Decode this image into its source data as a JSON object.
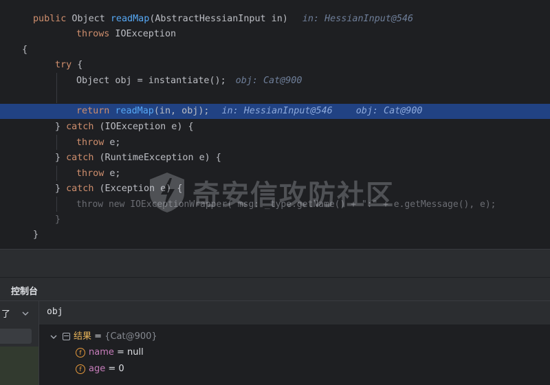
{
  "editor": {
    "lines": {
      "l1": {
        "kw": "public",
        "t1": " Object ",
        "fn": "readMap",
        "t2": "(AbstractHessianInput in)",
        "hint": "in: HessianInput@546"
      },
      "l2": {
        "kw": "throws",
        "t": " IOException"
      },
      "l3": {
        "t": "{"
      },
      "l4": {
        "kw": "try",
        "t": " {"
      },
      "l5": {
        "t": "Object obj = instantiate();",
        "hint": "obj: Cat@900"
      },
      "l7": {
        "kw": "return",
        "t1": " ",
        "fn": "readMap",
        "t2": "(in, obj);",
        "hint1": "in: HessianInput@546",
        "hint2": "obj: Cat@900"
      },
      "l8": {
        "t1": "} ",
        "kw": "catch",
        "t2": " (IOException e) {"
      },
      "l9": {
        "kw": "throw",
        "t": " e;"
      },
      "l10": {
        "t1": "} ",
        "kw": "catch",
        "t2": " (RuntimeException e) {"
      },
      "l11": {
        "kw": "throw",
        "t": " e;"
      },
      "l12": {
        "t1": "} ",
        "kw": "catch",
        "t2": " (Exception e) {"
      },
      "l13": {
        "t": "throw new IOExceptionWrapper( msg: _type.getName() + \":\" + e.getMessage(), e);"
      },
      "l14": {
        "t": "}"
      },
      "l15": {
        "t": "}"
      }
    }
  },
  "watermark": {
    "text": "奇安信攻防社区"
  },
  "console": {
    "title": "控制台"
  },
  "variables": {
    "left_label": "了",
    "expression": "obj",
    "root": {
      "name": "结果",
      "eq": " = ",
      "value": "{Cat@900}"
    },
    "fields": [
      {
        "name": "name",
        "eq": " = ",
        "value": "null"
      },
      {
        "name": "age",
        "eq": " = ",
        "value": "0"
      }
    ]
  },
  "colors": {
    "keyword": "#cf8e6d",
    "method": "#56a8f5",
    "highlight": "#214283",
    "background": "#1e1f22"
  }
}
